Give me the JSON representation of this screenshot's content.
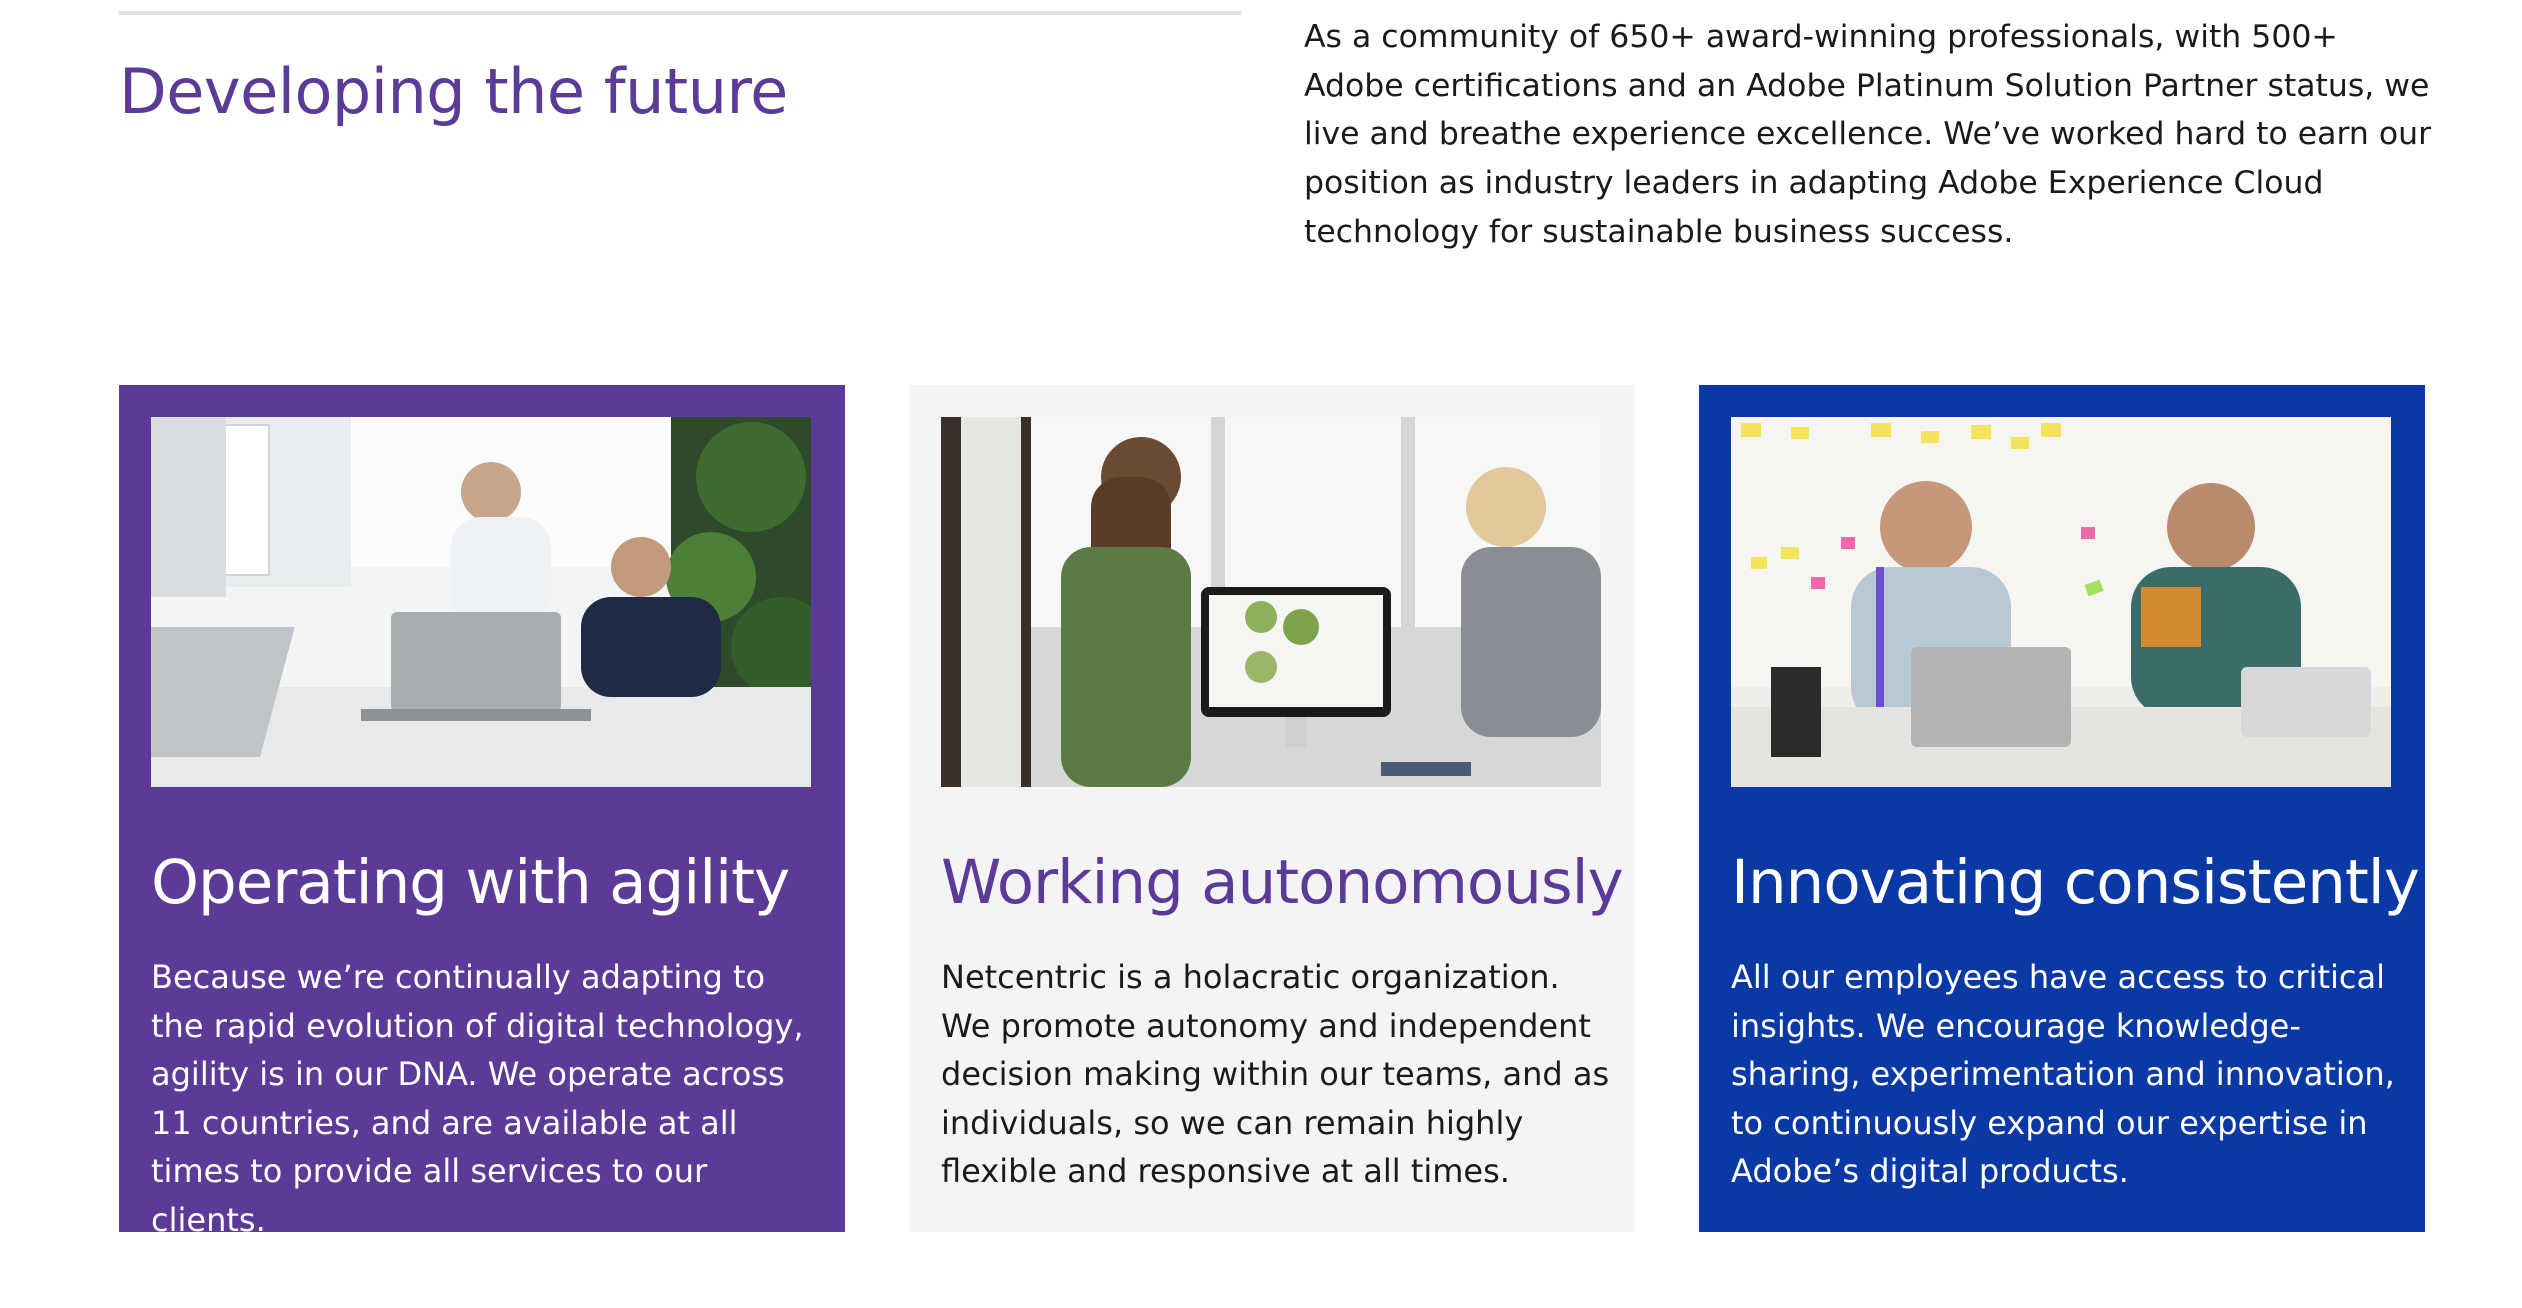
{
  "section": {
    "title": "Developing the future",
    "intro": "As a community of 650+ award-winning professionals, with 500+ Adobe certifications and an Adobe Platinum Solution Partner status, we live and breathe experience excellence. We’ve worked hard to earn our position as industry leaders in adapting Adobe Experience Cloud technology for sustainable business success."
  },
  "cards": [
    {
      "title": "Operating with agility",
      "text": "Because we’re continually adapting to the rapid evolution of digital technology, agility is in our DNA. We operate across 11 countries, and are available at all times to provide all services to our clients.",
      "image": "office-team-laptop-photo",
      "background_color": "#5b3a98"
    },
    {
      "title": "Working autonomously",
      "text": "Netcentric is a holacratic organization. We promote autonomy and independent decision making within our teams, and as individuals, so we can remain highly flexible and responsive at all times.",
      "image": "colleagues-at-monitor-photo",
      "background_color": "#f4f4f4"
    },
    {
      "title": "Innovating consistently",
      "text": "All our employees have access to critical insights. We encourage knowledge-sharing, experimentation and innovation, to continuously expand our expertise in Adobe’s digital products.",
      "image": "whiteboard-discussion-photo",
      "background_color": "#0a38a4"
    }
  ],
  "colors": {
    "accent_purple": "#5b3a98",
    "accent_blue": "#0a38a4",
    "card_gray": "#f4f4f4",
    "rule": "#e2e2e2"
  }
}
